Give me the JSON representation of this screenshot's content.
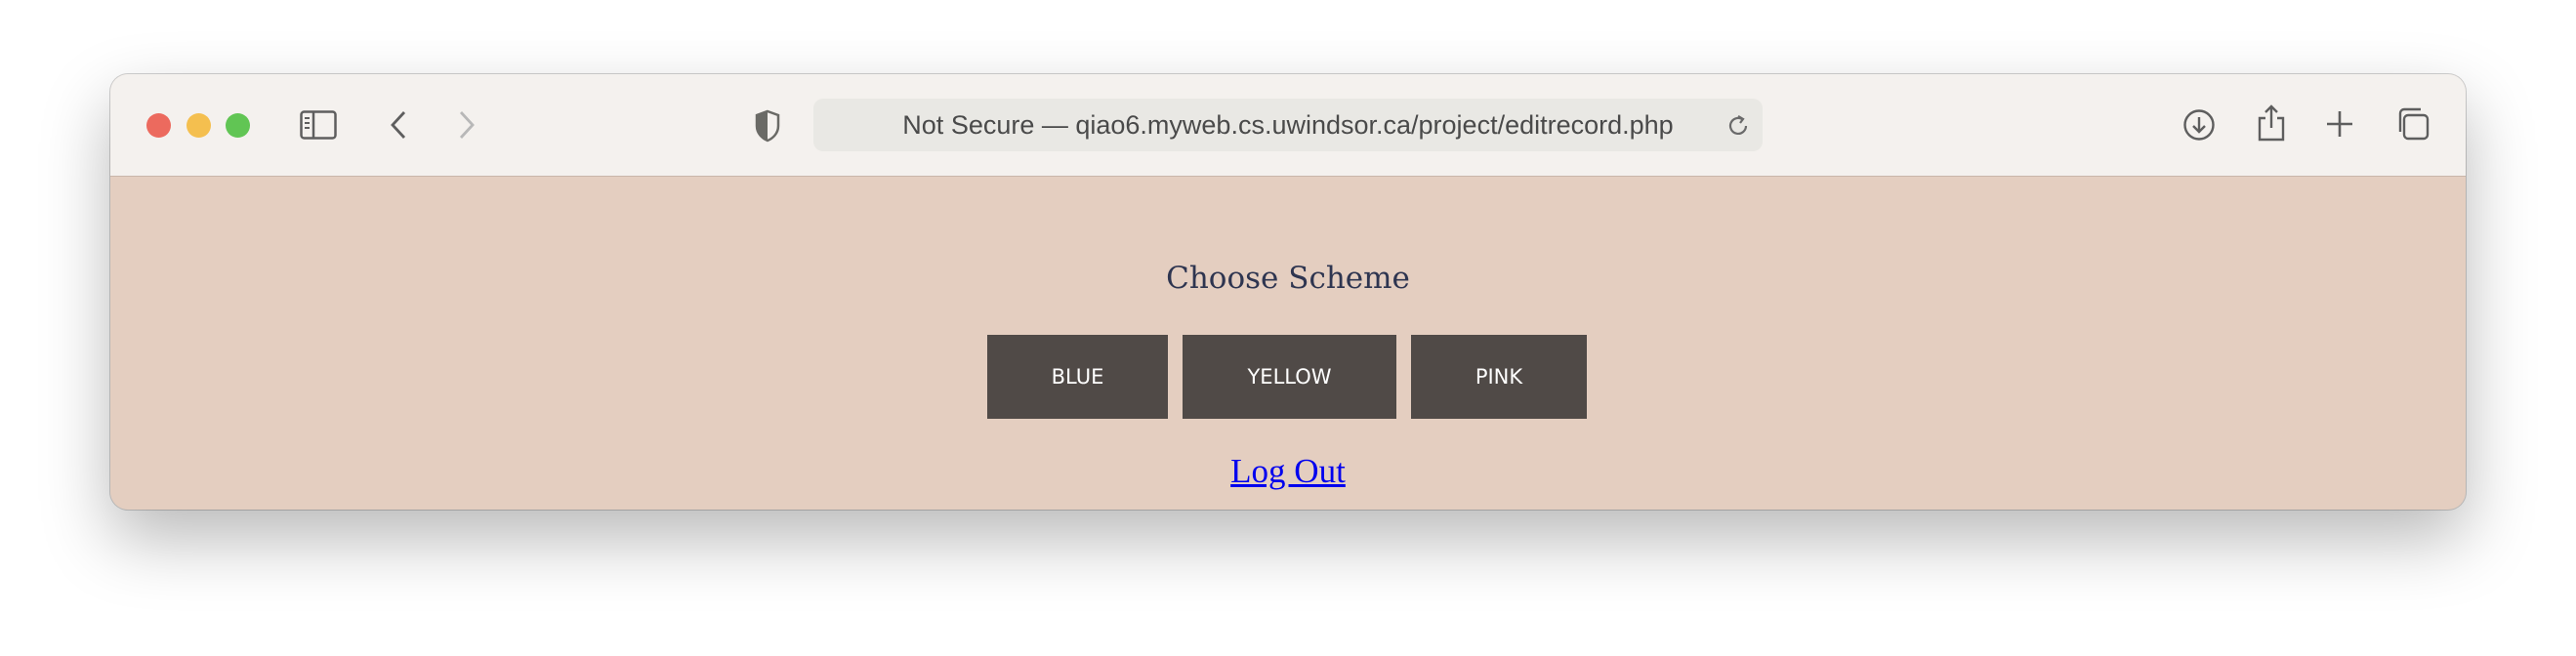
{
  "browser": {
    "url_text": "Not Secure — qiao6.myweb.cs.uwindsor.ca/project/editrecord.php",
    "icons": [
      "close-icon",
      "minimize-icon",
      "zoom-icon",
      "sidebar-icon",
      "back-icon",
      "forward-icon",
      "shield-icon",
      "reload-icon",
      "download-icon",
      "share-icon",
      "new-tab-icon",
      "tab-overview-icon"
    ]
  },
  "page": {
    "title": "Choose Scheme",
    "buttons": [
      {
        "label": "BLUE"
      },
      {
        "label": "YELLOW"
      },
      {
        "label": "PINK"
      }
    ],
    "logout_label": "Log Out",
    "colors": {
      "background": "#e4cec0",
      "button": "#504a47",
      "link": "#0000ee",
      "title": "#2e3550"
    }
  }
}
